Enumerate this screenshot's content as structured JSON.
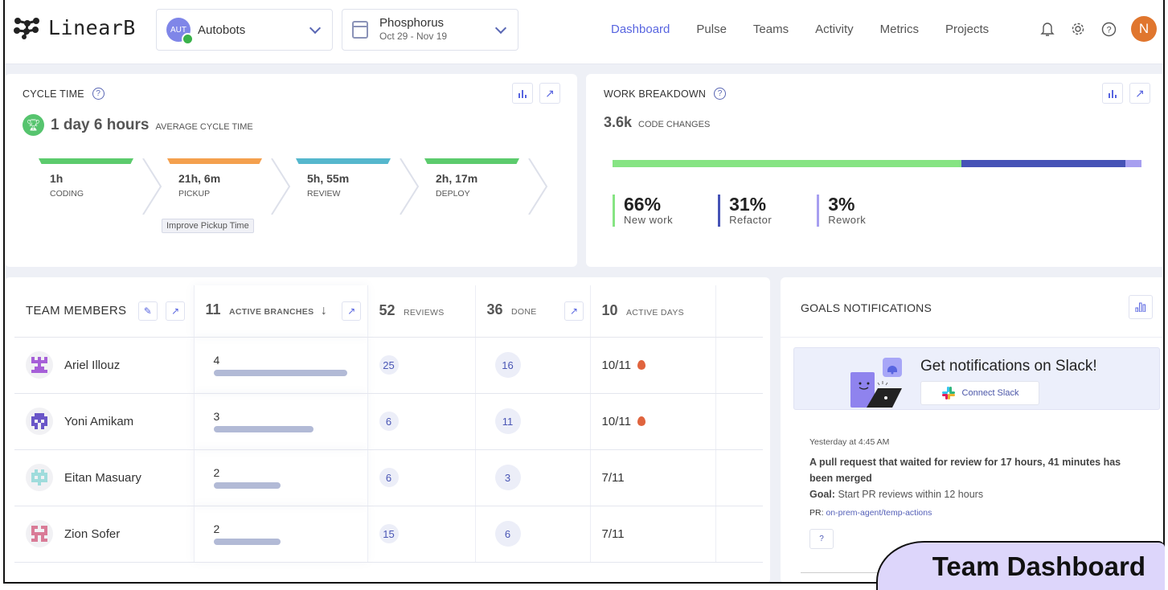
{
  "app": {
    "logo_text": "LinearB"
  },
  "team_selector": {
    "avatar_text": "AUT",
    "label": "Autobots"
  },
  "project_selector": {
    "name": "Phosphorus",
    "date_range": "Oct 29 - Nov 19"
  },
  "nav": {
    "items": [
      {
        "label": "Dashboard",
        "active": true
      },
      {
        "label": "Pulse"
      },
      {
        "label": "Teams"
      },
      {
        "label": "Activity"
      },
      {
        "label": "Metrics"
      },
      {
        "label": "Projects"
      }
    ]
  },
  "user": {
    "initial": "N"
  },
  "cycle_time": {
    "title": "CYCLE TIME",
    "value": "1 day 6 hours",
    "sublabel": "AVERAGE CYCLE TIME",
    "stages": [
      {
        "value": "1h",
        "label": "CODING",
        "color": "#5ccb6d"
      },
      {
        "value": "21h, 6m",
        "label": "PICKUP",
        "color": "#f4a04e"
      },
      {
        "value": "5h, 55m",
        "label": "REVIEW",
        "color": "#55b7cd"
      },
      {
        "value": "2h, 17m",
        "label": "DEPLOY",
        "color": "#5ccb6d"
      }
    ],
    "improve_button": "Improve Pickup Time"
  },
  "work_breakdown": {
    "title": "WORK BREAKDOWN",
    "value": "3.6k",
    "sublabel": "CODE CHANGES",
    "segments": [
      {
        "pct": 66,
        "value": "66%",
        "label": "New work",
        "color": "#86e483"
      },
      {
        "pct": 31,
        "value": "31%",
        "label": "Refactor",
        "color": "#4653b6"
      },
      {
        "pct": 3,
        "value": "3%",
        "label": "Rework",
        "color": "#a79ff0"
      }
    ]
  },
  "team_table": {
    "title": "TEAM MEMBERS",
    "columns": [
      {
        "num": "11",
        "label": "ACTIVE BRANCHES"
      },
      {
        "num": "52",
        "label": "REVIEWS"
      },
      {
        "num": "36",
        "label": "DONE"
      },
      {
        "num": "10",
        "label": "ACTIVE DAYS"
      }
    ],
    "branches_max": 4,
    "rows": [
      {
        "name": "Ariel Illouz",
        "branches": "4",
        "reviews": "25",
        "done": "16",
        "days": "10/11",
        "hot": true,
        "avatar_color": "#a65fd8"
      },
      {
        "name": "Yoni Amikam",
        "branches": "3",
        "reviews": "6",
        "done": "11",
        "days": "10/11",
        "hot": true,
        "avatar_color": "#6a56c8"
      },
      {
        "name": "Eitan Masuary",
        "branches": "2",
        "reviews": "6",
        "done": "3",
        "days": "7/11",
        "hot": false,
        "avatar_color": "#9fdcdc"
      },
      {
        "name": "Zion Sofer",
        "branches": "2",
        "reviews": "15",
        "done": "6",
        "days": "7/11",
        "hot": false,
        "avatar_color": "#d97b97"
      }
    ]
  },
  "goals": {
    "title": "GOALS NOTIFICATIONS",
    "slack_title": "Get notifications on Slack!",
    "slack_button": "Connect Slack",
    "notification": {
      "time": "Yesterday at 4:45 AM",
      "message": "A pull request that waited for review for 17 hours, 41 minutes has been merged",
      "goal_label": "Goal:",
      "goal_text": "Start PR reviews within 12 hours",
      "pr_label": "PR:",
      "pr_link": "on-prem-agent/temp-actions",
      "help_button": "?"
    }
  },
  "badge": {
    "text": "Team Dashboard"
  }
}
